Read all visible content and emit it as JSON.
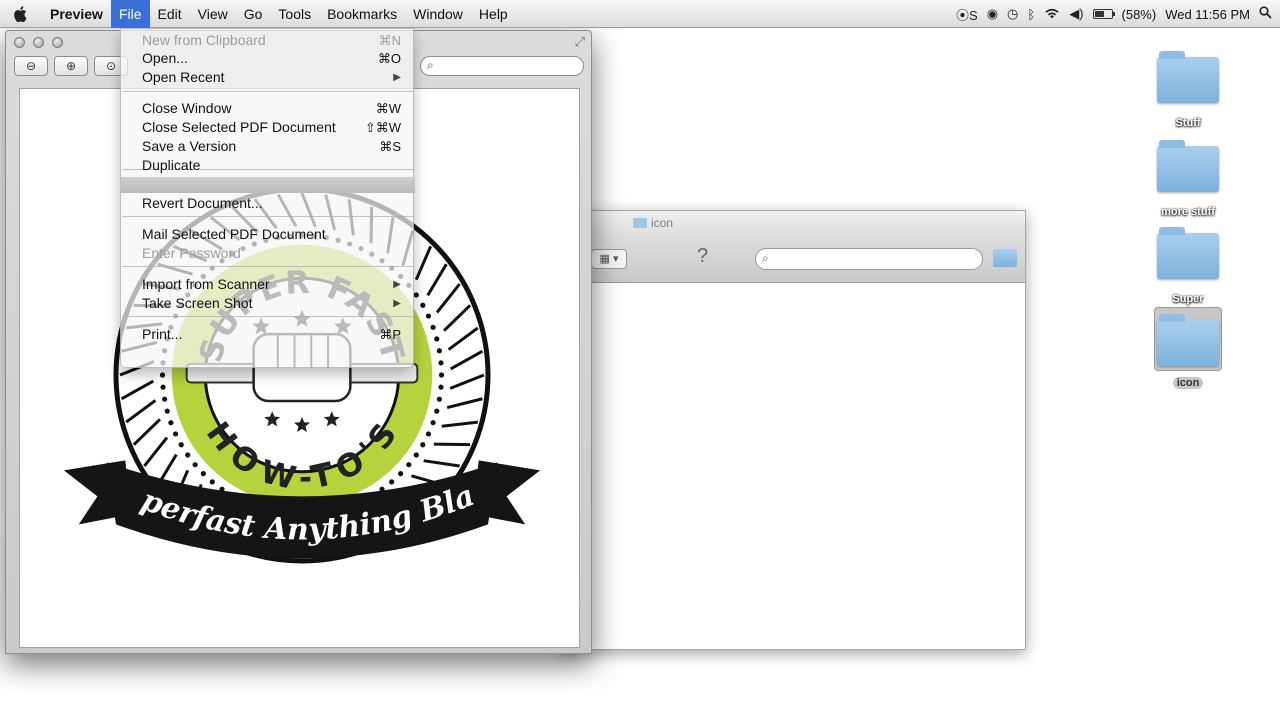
{
  "menubar": {
    "app_name": "Preview",
    "items": [
      "File",
      "Edit",
      "View",
      "Go",
      "Tools",
      "Bookmarks",
      "Window",
      "Help"
    ],
    "status": {
      "input_label": "S",
      "battery_percent": "(58%)",
      "battery_level": 0.58,
      "clock": "Wed 11:56 PM"
    }
  },
  "file_menu": {
    "items": [
      {
        "label": "New from Clipboard",
        "shortcut": "⌘N",
        "state": "disabled"
      },
      {
        "label": "Open...",
        "shortcut": "⌘O",
        "state": "enabled"
      },
      {
        "label": "Open Recent",
        "shortcut": "",
        "state": "enabled",
        "submenu": true
      },
      {
        "label": "Close Window",
        "shortcut": "⌘W",
        "state": "enabled"
      },
      {
        "label": "Close Selected PDF Document",
        "shortcut": "⇧⌘W",
        "state": "enabled"
      },
      {
        "label": "Save a Version",
        "shortcut": "⌘S",
        "state": "enabled"
      },
      {
        "label": "Duplicate",
        "shortcut": "",
        "state": "enabled"
      },
      {
        "label": "",
        "shortcut": "",
        "state": "highlighted"
      },
      {
        "label": "Revert Document...",
        "shortcut": "",
        "state": "enabled"
      },
      {
        "label": "Mail Selected PDF Document",
        "shortcut": "",
        "state": "enabled"
      },
      {
        "label": "Enter Password",
        "shortcut": "",
        "state": "disabled"
      },
      {
        "label": "Import from Scanner",
        "shortcut": "",
        "state": "enabled",
        "submenu": true
      },
      {
        "label": "Take Screen Shot",
        "shortcut": "",
        "state": "enabled",
        "submenu": true
      },
      {
        "label": "Print...",
        "shortcut": "⌘P",
        "state": "enabled"
      }
    ]
  },
  "badge": {
    "top_text": "SUPER FAST",
    "bottom_text": "HOW-TO'S",
    "ribbon_text": "Superfast Anything Blast",
    "accent_color": "#b5d33d"
  },
  "finder": {
    "title": "icon"
  },
  "desktop": {
    "icons": [
      {
        "label": "Stuff",
        "selected": false
      },
      {
        "label": "more stuff",
        "selected": false
      },
      {
        "label": "Super",
        "selected": false
      },
      {
        "label": "icon",
        "selected": true
      }
    ]
  }
}
